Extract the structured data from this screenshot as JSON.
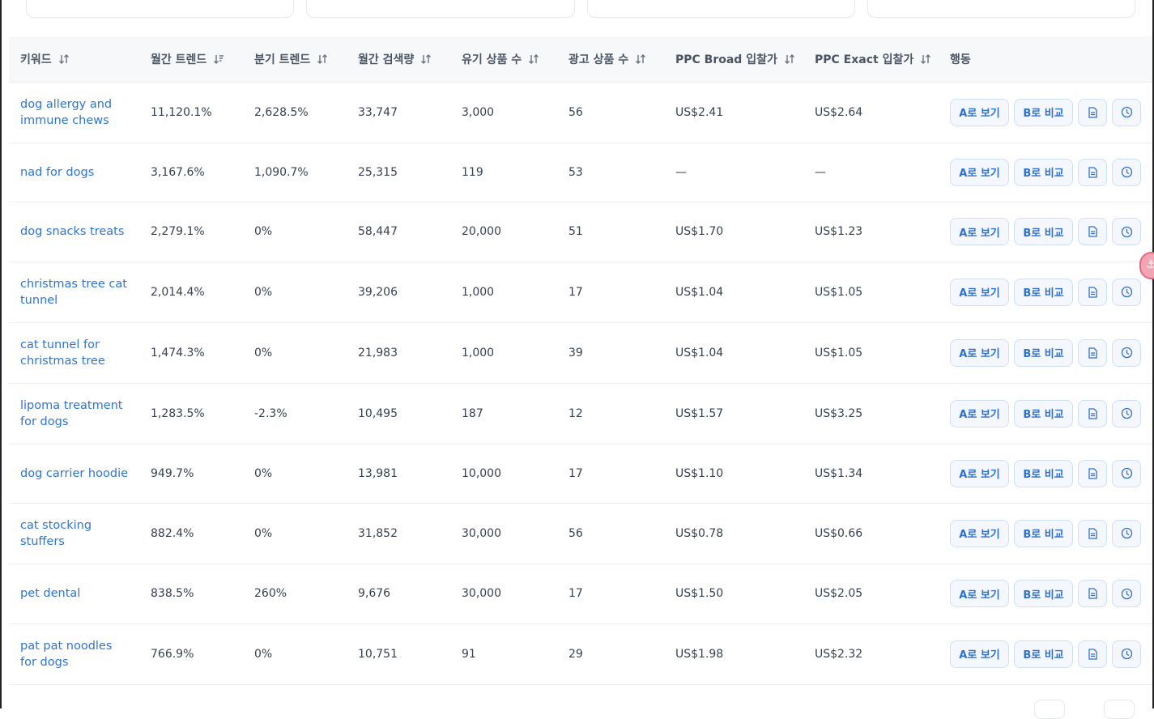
{
  "table": {
    "headers": [
      {
        "label": "키워드",
        "sort": "both"
      },
      {
        "label": "월간 트렌드",
        "sort": "desc"
      },
      {
        "label": "분기 트렌드",
        "sort": "both"
      },
      {
        "label": "월간 검색량",
        "sort": "both"
      },
      {
        "label": "유기 상품 수",
        "sort": "both"
      },
      {
        "label": "광고 상품 수",
        "sort": "both"
      },
      {
        "label": "PPC Broad 입찰가",
        "sort": "both"
      },
      {
        "label": "PPC Exact 입찰가",
        "sort": "both"
      },
      {
        "label": "행동",
        "sort": "none"
      }
    ],
    "rows": [
      {
        "keyword": "dog allergy and immune chews",
        "monthly_trend": "11,120.1%",
        "quarterly_trend": "2,628.5%",
        "monthly_search": "33,747",
        "organic": "3,000",
        "ads": "56",
        "ppc_broad": "US$2.41",
        "ppc_exact": "US$2.64"
      },
      {
        "keyword": "nad for dogs",
        "monthly_trend": "3,167.6%",
        "quarterly_trend": "1,090.7%",
        "monthly_search": "25,315",
        "organic": "119",
        "ads": "53",
        "ppc_broad": "—",
        "ppc_exact": "—"
      },
      {
        "keyword": "dog snacks treats",
        "monthly_trend": "2,279.1%",
        "quarterly_trend": "0%",
        "monthly_search": "58,447",
        "organic": "20,000",
        "ads": "51",
        "ppc_broad": "US$1.70",
        "ppc_exact": "US$1.23"
      },
      {
        "keyword": "christmas tree cat tunnel",
        "monthly_trend": "2,014.4%",
        "quarterly_trend": "0%",
        "monthly_search": "39,206",
        "organic": "1,000",
        "ads": "17",
        "ppc_broad": "US$1.04",
        "ppc_exact": "US$1.05"
      },
      {
        "keyword": "cat tunnel for christmas tree",
        "monthly_trend": "1,474.3%",
        "quarterly_trend": "0%",
        "monthly_search": "21,983",
        "organic": "1,000",
        "ads": "39",
        "ppc_broad": "US$1.04",
        "ppc_exact": "US$1.05"
      },
      {
        "keyword": "lipoma treatment for dogs",
        "monthly_trend": "1,283.5%",
        "quarterly_trend": "-2.3%",
        "monthly_search": "10,495",
        "organic": "187",
        "ads": "12",
        "ppc_broad": "US$1.57",
        "ppc_exact": "US$3.25"
      },
      {
        "keyword": "dog carrier hoodie",
        "monthly_trend": "949.7%",
        "quarterly_trend": "0%",
        "monthly_search": "13,981",
        "organic": "10,000",
        "ads": "17",
        "ppc_broad": "US$1.10",
        "ppc_exact": "US$1.34"
      },
      {
        "keyword": "cat stocking stuffers",
        "monthly_trend": "882.4%",
        "quarterly_trend": "0%",
        "monthly_search": "31,852",
        "organic": "30,000",
        "ads": "56",
        "ppc_broad": "US$0.78",
        "ppc_exact": "US$0.66"
      },
      {
        "keyword": "pet dental",
        "monthly_trend": "838.5%",
        "quarterly_trend": "260%",
        "monthly_search": "9,676",
        "organic": "30,000",
        "ads": "17",
        "ppc_broad": "US$1.50",
        "ppc_exact": "US$2.05"
      },
      {
        "keyword": "pat pat noodles for dogs",
        "monthly_trend": "766.9%",
        "quarterly_trend": "0%",
        "monthly_search": "10,751",
        "organic": "91",
        "ads": "29",
        "ppc_broad": "US$1.98",
        "ppc_exact": "US$2.32"
      }
    ],
    "actions": {
      "view_a_label": "A로 보기",
      "compare_b_label": "B로 비교",
      "doc_icon": "document-icon",
      "history_icon": "clock-icon"
    }
  },
  "colors": {
    "link": "#2f74d8",
    "button_text": "#2f6fd0",
    "header_bg": "#f7f8fa"
  }
}
